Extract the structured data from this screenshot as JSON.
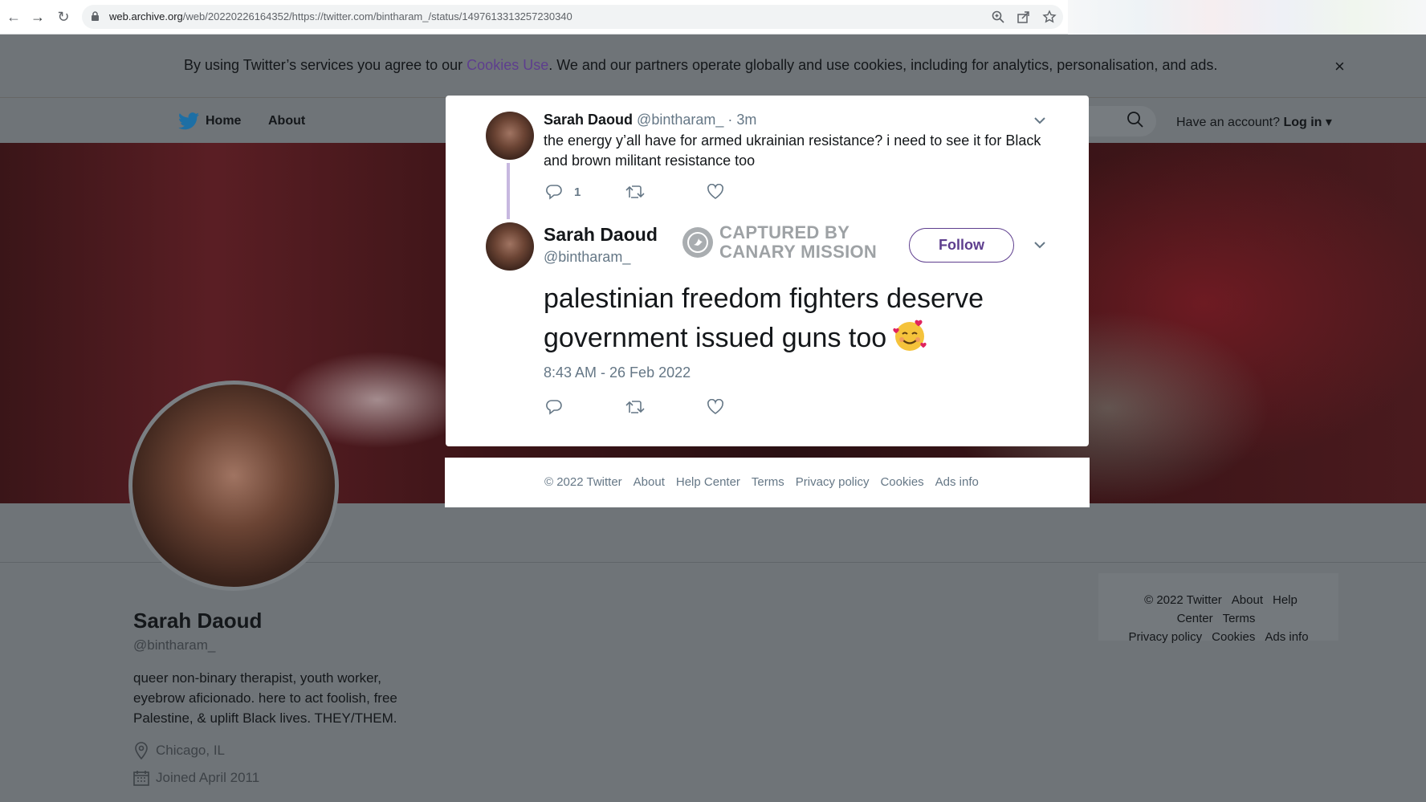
{
  "browser": {
    "url_host": "web.archive.org",
    "url_path": "/web/20220226164352/https://twitter.com/bintharam_/status/1497613313257230340"
  },
  "cookie_banner": {
    "prefix": "By using Twitter’s services you agree to our ",
    "link": "Cookies Use",
    "suffix": ". We and our partners operate globally and use cookies, including for analytics, personalisation, and ads.",
    "close": "×"
  },
  "nav": {
    "home": "Home",
    "about": "About",
    "account_prompt": "Have an account?",
    "login": "Log in"
  },
  "profile": {
    "name": "Sarah Daoud",
    "handle": "@bintharam_",
    "bio": "queer non-binary therapist, youth worker, eyebrow aficionado. here to act foolish, free Palestine, & uplift Black lives. THEY/THEM.",
    "location": "Chicago, IL",
    "joined": "Joined April 2011"
  },
  "side_footer": {
    "row1": [
      "© 2022 Twitter",
      "About",
      "Help Center",
      "Terms"
    ],
    "row2": [
      "Privacy policy",
      "Cookies",
      "Ads info"
    ]
  },
  "tweet_parent": {
    "name": "Sarah Daoud",
    "handle": "@bintharam_",
    "age": "· 3m",
    "text": "the energy y’all have for armed ukrainian resistance? i need to see it for Black and brown militant resistance too",
    "reply_count": "1"
  },
  "tweet_main": {
    "name": "Sarah Daoud",
    "handle": "@bintharam_",
    "watermark_line1": "CAPTURED BY",
    "watermark_line2": "CANARY MISSION",
    "follow": "Follow",
    "text": "palestinian freedom fighters deserve government issued guns too",
    "timestamp": "8:43 AM - 26 Feb 2022"
  },
  "modal_footer": [
    "© 2022 Twitter",
    "About",
    "Help Center",
    "Terms",
    "Privacy policy",
    "Cookies",
    "Ads info"
  ],
  "colors": {
    "overlay": "#6f7478",
    "link": "#5e3e8e",
    "muted": "#657786",
    "twitter_blue": "#1da1f2"
  }
}
